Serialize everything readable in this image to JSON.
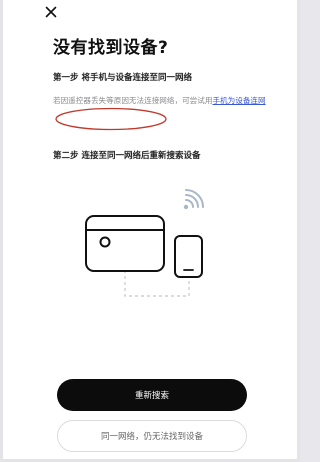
{
  "header": {
    "close_icon": "close-icon"
  },
  "title": "没有找到设备?",
  "step1": {
    "label": "第一步 将手机与设备连接至同一网络",
    "hint_text": "若因遥控器丢失等原因无法连接网络，可尝试用",
    "hint_link": "手机为设备连网",
    "annotation_color": "#c0392b"
  },
  "step2": {
    "label": "第二步 连接至同一网络后重新搜索设备"
  },
  "illustration": {
    "icons": [
      "tv-icon",
      "phone-icon",
      "wifi-icon"
    ]
  },
  "actions": {
    "primary_label": "重新搜索",
    "secondary_label": "同一网络，仍无法找到设备"
  },
  "colors": {
    "primary": "#0c0c0c",
    "link": "#3a57d6",
    "wifi": "#a9b7c9"
  }
}
